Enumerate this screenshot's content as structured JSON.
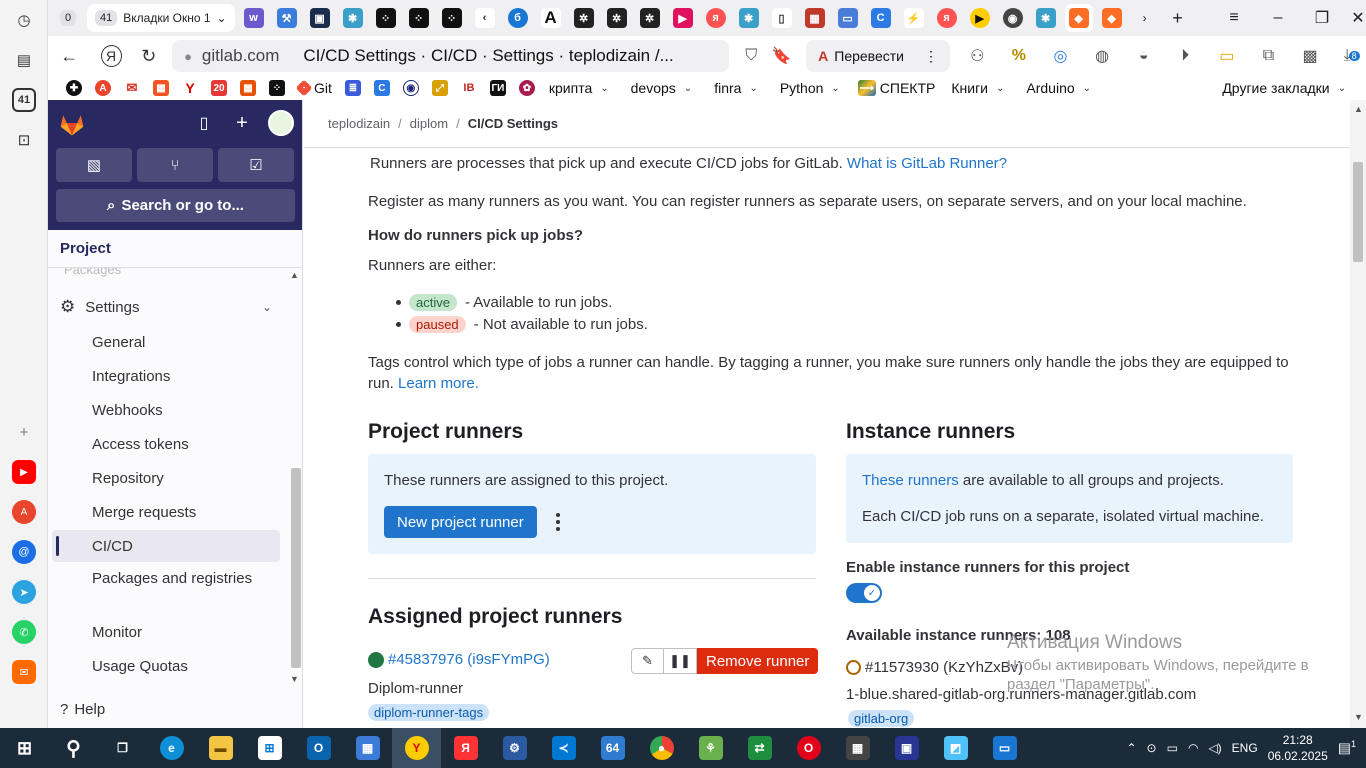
{
  "browser": {
    "active_tab_count": "41",
    "active_tab_title": "Вкладки Окно 1",
    "url_host": "gitlab.com",
    "page_title": "CI/CD Settings · CI/CD · Settings · teplodizain /...",
    "translate_label": "Перевести",
    "inactive_tab_count": "0",
    "rail_badge": "41",
    "ext_badge": "8"
  },
  "bookmarks": [
    {
      "label": "Git"
    },
    {
      "label": "крипта"
    },
    {
      "label": "devops"
    },
    {
      "label": "finra"
    },
    {
      "label": "Python"
    },
    {
      "label": "СПЕКТР"
    },
    {
      "label": "Книги"
    },
    {
      "label": "Arduino"
    },
    {
      "label": "Другие закладки"
    }
  ],
  "sidebar": {
    "search_label": "Search or go to...",
    "context": "Project",
    "faded_item": "Packages",
    "settings_label": "Settings",
    "items": [
      "General",
      "Integrations",
      "Webhooks",
      "Access tokens",
      "Repository",
      "Merge requests",
      "CI/CD",
      "Packages and registries",
      "Monitor",
      "Usage Quotas"
    ],
    "help": "Help"
  },
  "breadcrumb": {
    "group": "teplodizain",
    "project": "diplom",
    "current": "CI/CD Settings"
  },
  "intro": {
    "line1": "Runners are processes that pick up and execute CI/CD jobs for GitLab.",
    "line1_link": "What is GitLab Runner?",
    "line2": "Register as many runners as you want. You can register runners as separate users, on separate servers, and on your local machine.",
    "heading": "How do runners pick up jobs?",
    "either": "Runners are either:",
    "active_badge": "active",
    "active_text": "- Available to run jobs.",
    "paused_badge": "paused",
    "paused_text": "- Not available to run jobs.",
    "tags_text": "Tags control which type of jobs a runner can handle. By tagging a runner, you make sure runners only handle the jobs they are equipped to run.",
    "learn_more": "Learn more."
  },
  "project_runners": {
    "title": "Project runners",
    "panel_text": "These runners are assigned to this project.",
    "new_button": "New project runner",
    "assigned_title": "Assigned project runners",
    "runner_id": "#45837976 (i9sFYmPG)",
    "runner_name": "Diplom-runner",
    "runner_tag": "diplom-runner-tags",
    "remove_button": "Remove runner"
  },
  "instance_runners": {
    "title": "Instance runners",
    "panel_link": "These runners",
    "panel_text": "are available to all groups and projects.",
    "panel_text2": "Each CI/CD job runs on a separate, isolated virtual machine.",
    "enable_label": "Enable instance runners for this project",
    "enabled": true,
    "available_label": "Available instance runners: 108",
    "runner_id": "#11573930 (KzYhZxBv)",
    "runner_host": "1-blue.shared-gitlab-org.runners-manager.gitlab.com",
    "runner_tag": "gitlab-org"
  },
  "watermark": {
    "line1": "Активация Windows",
    "line2": "Чтобы активировать Windows, перейдите в",
    "line3": "раздел \"Параметры\"."
  },
  "taskbar": {
    "lang": "ENG",
    "time": "21:28",
    "date": "06.02.2025",
    "notif_count": "1"
  },
  "colors": {
    "sidebar_top": "#292961",
    "link": "#1f75cb",
    "danger": "#dd2b0e",
    "panel": "#e9f3fc"
  }
}
